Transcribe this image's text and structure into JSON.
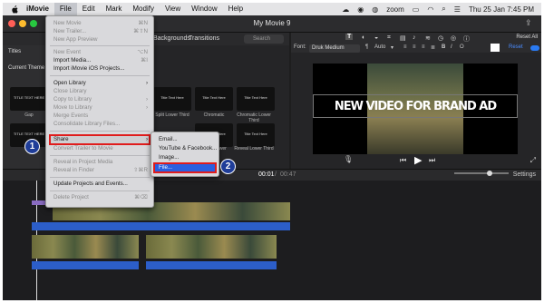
{
  "menubar": {
    "app": "iMovie",
    "items": [
      "File",
      "Edit",
      "Mark",
      "Modify",
      "View",
      "Window",
      "Help"
    ],
    "clock": "Thu 25 Jan 7:45 PM",
    "zoom": "zoom"
  },
  "window": {
    "title": "My Movie 9"
  },
  "browser": {
    "tabs": [
      "Backgrounds",
      "Transitions"
    ],
    "search_placeholder": "Search",
    "sidebar_title": "Titles",
    "section": "Current Theme",
    "thumbs": [
      {
        "text": "TITLE TEXT HERE",
        "caption": "Gap"
      },
      {
        "text": "Title Text Here",
        "caption": "Split Lower Third"
      },
      {
        "text": "Title Text Here",
        "caption": "Chromatic"
      },
      {
        "text": "Title Text Here",
        "caption": "Chromatic Lower Third"
      },
      {
        "text": "TITLE TEXT HERE",
        "caption": ""
      },
      {
        "text": "Title Text Here",
        "caption": "Pixelated Lower Third"
      },
      {
        "text": "Title Text Here",
        "caption": "Reveal Lower Third"
      }
    ]
  },
  "viewer": {
    "reset_all": "Reset All",
    "font_label": "Font:",
    "font_value": "Druk Medium",
    "size": "Auto",
    "reset": "Reset",
    "video_title": "NEW VIDEO FOR BRAND AD"
  },
  "midbar": {
    "current": "00:01",
    "total": "00:47",
    "settings": "Settings"
  },
  "file_menu": {
    "items": [
      {
        "label": "New Movie",
        "shortcut": "⌘N",
        "disabled": true
      },
      {
        "label": "New Trailer...",
        "shortcut": "",
        "disabled": true
      },
      {
        "label": "New App Preview",
        "shortcut": "",
        "disabled": true
      },
      {
        "label": "New Event",
        "shortcut": "⌥N",
        "disabled": true
      },
      {
        "label": "Import Media...",
        "shortcut": "⌘I",
        "disabled": false
      },
      {
        "label": "Import iMovie iOS Projects...",
        "shortcut": "",
        "disabled": false
      },
      {
        "label": "Open Library",
        "shortcut": "",
        "disabled": false
      },
      {
        "label": "Close Library",
        "shortcut": "",
        "disabled": true
      },
      {
        "label": "Copy to Library",
        "shortcut": "",
        "disabled": true
      },
      {
        "label": "Move to Library",
        "shortcut": "",
        "disabled": true
      },
      {
        "label": "Merge Events",
        "shortcut": "",
        "disabled": true
      },
      {
        "label": "Consolidate Library Files...",
        "shortcut": "",
        "disabled": true
      },
      {
        "label": "Share",
        "shortcut": "",
        "disabled": false
      },
      {
        "label": "Convert Trailer to Movie",
        "shortcut": "",
        "disabled": true
      },
      {
        "label": "Reveal in Project Media",
        "shortcut": "",
        "disabled": true
      },
      {
        "label": "Reveal in Finder",
        "shortcut": "⇧⌘R",
        "disabled": true
      },
      {
        "label": "Update Projects and Events...",
        "shortcut": "",
        "disabled": false
      },
      {
        "label": "Delete Project",
        "shortcut": "",
        "disabled": true
      }
    ]
  },
  "share_menu": {
    "items": [
      "Email...",
      "YouTube & Facebook...",
      "Image...",
      "File..."
    ]
  },
  "callouts": [
    "1",
    "2"
  ],
  "colors": {
    "highlight": "#e01c1c",
    "selection": "#2a5fe0",
    "callout": "#1f3d98"
  }
}
